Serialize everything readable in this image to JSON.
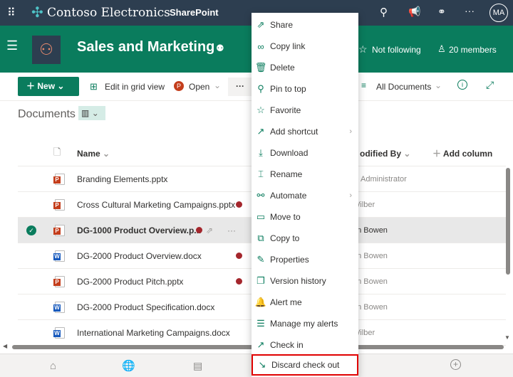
{
  "topbar": {
    "brand": "Contoso Electronics",
    "app": "SharePoint",
    "avatar": "MA"
  },
  "site": {
    "title": "Sales and Marketing",
    "follow": "Not following",
    "members": "20 members"
  },
  "commands": {
    "new": "New",
    "grid": "Edit in grid view",
    "open": "Open",
    "more": "···",
    "view": "All Documents"
  },
  "library": {
    "title": "Documents",
    "columns": {
      "name": "Name",
      "modified_by": "Modified By",
      "add_column": "Add column"
    }
  },
  "files": [
    {
      "name": "Branding Elements.pptx",
      "type": "pptx",
      "modified_by": "MOD Administrator",
      "checked_out": false
    },
    {
      "name": "Cross Cultural Marketing Campaigns.pptx",
      "type": "pptx",
      "modified_by": "Megan Wilber",
      "checked_out": true
    },
    {
      "name": "DG-1000 Product Overview.p...",
      "type": "pptx",
      "modified_by": "Megan Bowen",
      "checked_out": true,
      "selected": true
    },
    {
      "name": "DG-2000 Product Overview.docx",
      "type": "docx",
      "modified_by": "Megan Bowen",
      "checked_out": true
    },
    {
      "name": "DG-2000 Product Pitch.pptx",
      "type": "pptx",
      "modified_by": "Megan Bowen",
      "checked_out": true
    },
    {
      "name": "DG-2000 Product Specification.docx",
      "type": "docx",
      "modified_by": "Megan Bowen",
      "checked_out": false
    },
    {
      "name": "International Marketing Campaigns.docx",
      "type": "docx",
      "modified_by": "Megan Wilber",
      "checked_out": false
    }
  ],
  "visible_modified_by": [
    "O Administrator",
    "Wilber",
    "an Bowen",
    "an Bowen",
    "an Bowen",
    "an Bowen",
    "Wilber"
  ],
  "menu": [
    {
      "label": "Share",
      "icon": "share-icon",
      "glyph": "⇗"
    },
    {
      "label": "Copy link",
      "icon": "link-icon",
      "glyph": "∞"
    },
    {
      "label": "Delete",
      "icon": "trash-icon",
      "glyph": "🗑"
    },
    {
      "label": "Pin to top",
      "icon": "pin-icon",
      "glyph": "⚲"
    },
    {
      "label": "Favorite",
      "icon": "star-icon",
      "glyph": "☆"
    },
    {
      "label": "Add shortcut",
      "icon": "shortcut-icon",
      "glyph": "↗",
      "submenu": true
    },
    {
      "label": "Download",
      "icon": "download-icon",
      "glyph": "⤓"
    },
    {
      "label": "Rename",
      "icon": "rename-icon",
      "glyph": "⌶"
    },
    {
      "label": "Automate",
      "icon": "flow-icon",
      "glyph": "⚯",
      "submenu": true
    },
    {
      "label": "Move to",
      "icon": "move-icon",
      "glyph": "▭"
    },
    {
      "label": "Copy to",
      "icon": "copy-icon",
      "glyph": "⧉"
    },
    {
      "label": "Properties",
      "icon": "pencil-icon",
      "glyph": "✎"
    },
    {
      "label": "Version history",
      "icon": "history-icon",
      "glyph": "❐"
    },
    {
      "label": "Alert me",
      "icon": "bell-icon",
      "glyph": "🔔"
    },
    {
      "label": "Manage my alerts",
      "icon": "alerts-icon",
      "glyph": "☰"
    },
    {
      "label": "Check in",
      "icon": "checkin-icon",
      "glyph": "↗"
    },
    {
      "label": "Discard check out",
      "icon": "discard-icon",
      "glyph": "↘",
      "highlighted": true
    }
  ],
  "colors": {
    "topbar": "#2d3e50",
    "brand": "#0a7c5d",
    "checked_out": "#a4262c",
    "highlight": "#e00000"
  }
}
